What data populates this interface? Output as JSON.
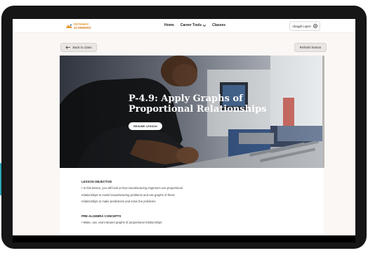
{
  "brand": {
    "line1": "PATHWAY",
    "line2": "2CAREERS"
  },
  "nav": {
    "home": "Home",
    "career_tools": "Career Tools",
    "classes": "Classes"
  },
  "user": {
    "name": "Abagail Lopez"
  },
  "actions": {
    "back": "Back to class",
    "refresh": "Refresh lesson",
    "resume": "RESUME LESSON"
  },
  "lesson": {
    "title_line1": "P-4.9: Apply Graphs of",
    "title_line2": "Proportional Relationships"
  },
  "objective": {
    "heading": "LESSON OBJECTIVE",
    "line1": "• In this lesson, you will look at how manufacturing engineers use proportional",
    "line2": "relationships to model manufacturing problems and use graphs of these",
    "line3": "relationships to make predictions and solve the problems."
  },
  "concepts": {
    "heading": "PRE-ALGEBRA CONCEPTS",
    "line1": "• Make, use, and interpret graphs of proportional relationships."
  },
  "colors": {
    "brand_orange": "#e2962b",
    "background": "#fbf7f5",
    "bezel": "#161616"
  }
}
